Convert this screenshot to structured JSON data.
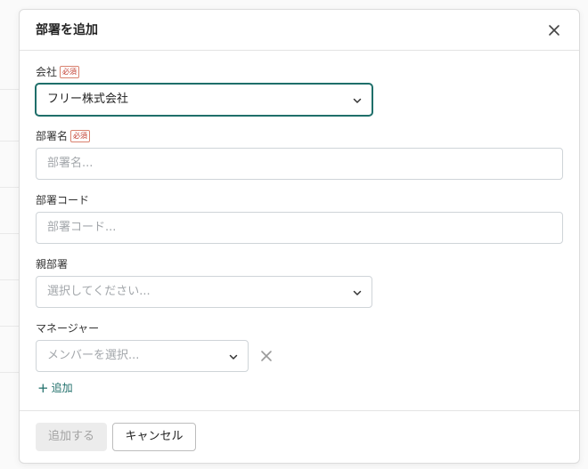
{
  "dialog": {
    "title": "部署を追加"
  },
  "fields": {
    "company": {
      "label": "会社",
      "required_badge": "必須",
      "value": "フリー株式会社"
    },
    "department_name": {
      "label": "部署名",
      "required_badge": "必須",
      "placeholder": "部署名..."
    },
    "department_code": {
      "label": "部署コード",
      "placeholder": "部署コード..."
    },
    "parent_department": {
      "label": "親部署",
      "placeholder": "選択してください..."
    },
    "manager": {
      "label": "マネージャー",
      "placeholder": "メンバーを選択..."
    }
  },
  "add_link": {
    "label": "追加"
  },
  "footer": {
    "submit_label": "追加する",
    "cancel_label": "キャンセル"
  },
  "colors": {
    "accent": "#1f6f6a",
    "required": "#c0392b"
  },
  "icons": {
    "close": "close-icon",
    "chevron": "chevron-down-icon",
    "remove": "remove-icon",
    "plus": "plus-icon"
  }
}
